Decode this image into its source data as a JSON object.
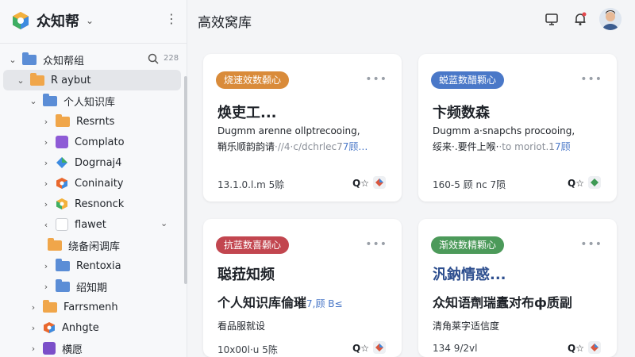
{
  "sidebar": {
    "brand": "众知帮",
    "brand_caret": "⌄",
    "more": "⋮",
    "search_count": "228",
    "tree": [
      {
        "label": "众知帮组",
        "chev": "⌄",
        "icon": "folder-blue"
      },
      {
        "label": "R aybut",
        "chev": "⌄",
        "icon": "folder-orange"
      },
      {
        "label": "个人知识库",
        "chev": "⌄",
        "icon": "folder-blue"
      },
      {
        "label": "Resrnts",
        "chev": "›",
        "icon": "folder-orange"
      },
      {
        "label": "Complato",
        "chev": "›",
        "icon": "app-purple"
      },
      {
        "label": "Dogrnaj4",
        "chev": "›",
        "icon": "app-gem"
      },
      {
        "label": "Coninaity",
        "chev": "›",
        "icon": "app-multi"
      },
      {
        "label": "Resnonck",
        "chev": "›",
        "icon": "app-multi2"
      },
      {
        "label": "flawet",
        "chev": "‹",
        "icon": "doc"
      },
      {
        "label": "绕备闲调库",
        "chev": "",
        "icon": "folder-orange"
      },
      {
        "label": "Rentoxia",
        "chev": "›",
        "icon": "folder-blue"
      },
      {
        "label": "绍知期",
        "chev": "›",
        "icon": "folder-blue"
      },
      {
        "label": "Farrsmenh",
        "chev": "›",
        "icon": "folder-orange"
      },
      {
        "label": "Anhgte",
        "chev": "›",
        "icon": "app-multi"
      },
      {
        "label": "横愿",
        "chev": "›",
        "icon": "app-purple2"
      }
    ]
  },
  "header": {
    "title": "高效窝库"
  },
  "cards": [
    {
      "badge": "烧速效数颡心",
      "badge_color": "#d98b3a",
      "title": "焕吏工...",
      "line1": "Dugmm arenne ollptrecooing,",
      "line2_a": "鞘乐顺韵韵请",
      "line2_b": "·//4·c/dchrlec7",
      "line2_c": "7顾…",
      "footer": "13.1.0.l.m 5赊",
      "user": "Q☆",
      "gem": "#d9573f"
    },
    {
      "badge": "蜕蓝数醋颗心",
      "badge_color": "#4a78c8",
      "title": "卞频数森",
      "line1": "Dugmm a·snapchs procooing,",
      "line2_a": "绥来·.要件上喉·",
      "line2_b": "·to moriot.1",
      "line2_c": "7顾",
      "footer": "160-5 顾 nc 7陨",
      "user": "Q☆",
      "gem": "#3f9a55"
    },
    {
      "badge": "抗蓝数喜颡心",
      "badge_color": "#c2464f",
      "title": "聪菈知频",
      "line1": "个人知识库倫璀",
      "line1_b": "7,顾 B≤",
      "line2_a": "看品服就设",
      "footer": "10x00l·u 5陈",
      "user": "Q☆",
      "gem": "#d9573f"
    },
    {
      "badge": "渐效数精颗心",
      "badge_color": "#4c9a5a",
      "title": "汎鈉情惑...",
      "line1": "众知语劑瑞蠹对布ф质副",
      "line2_a": "清角莱字适信度",
      "footer": "134 9/2vl",
      "user": "Q☆",
      "gem": "#d9573f"
    }
  ]
}
